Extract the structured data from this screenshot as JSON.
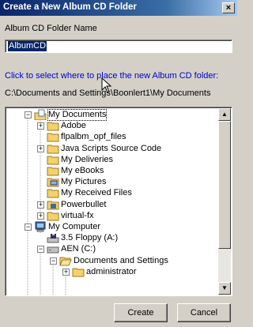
{
  "window": {
    "title": "Create a New Album CD Folder",
    "close_label": "×"
  },
  "form": {
    "name_label": "Album CD Folder Name",
    "name_value": "AlbumCD",
    "hint": "Click to select where to place the new Album CD folder:",
    "current_path": "C:\\Documents and Settings\\Boonlert1\\My Documents"
  },
  "tree": {
    "nodes": [
      {
        "label": "My Documents",
        "icon": "my-documents-icon",
        "expander": "minus",
        "selected": true
      },
      {
        "label": "Adobe",
        "icon": "folder-icon",
        "expander": "plus"
      },
      {
        "label": "flpalbm_opf_files",
        "icon": "folder-icon",
        "expander": ""
      },
      {
        "label": "Java Scripts Source Code",
        "icon": "folder-icon",
        "expander": "plus"
      },
      {
        "label": "My Deliveries",
        "icon": "folder-icon",
        "expander": ""
      },
      {
        "label": "My eBooks",
        "icon": "folder-icon",
        "expander": ""
      },
      {
        "label": "My Pictures",
        "icon": "pictures-folder-icon",
        "expander": ""
      },
      {
        "label": "My Received Files",
        "icon": "folder-icon",
        "expander": ""
      },
      {
        "label": "Powerbullet",
        "icon": "app-folder-icon",
        "expander": "plus"
      },
      {
        "label": "virtual-fx",
        "icon": "folder-icon",
        "expander": "plus"
      },
      {
        "label": "My Computer",
        "icon": "computer-icon",
        "expander": "minus"
      },
      {
        "label": "3.5 Floppy (A:)",
        "icon": "floppy-drive-icon",
        "expander": ""
      },
      {
        "label": "AEN (C:)",
        "icon": "hard-drive-icon",
        "expander": "minus"
      },
      {
        "label": "Documents and Settings",
        "icon": "folder-open-icon",
        "expander": "minus"
      },
      {
        "label": "administrator",
        "icon": "folder-icon",
        "expander": "plus"
      }
    ]
  },
  "buttons": {
    "create": "Create",
    "cancel": "Cancel"
  },
  "colors": {
    "titlebar": "#0a246a",
    "selection": "#0a246a",
    "hint_text": "#0000cc",
    "folder": "#f5d16b"
  }
}
